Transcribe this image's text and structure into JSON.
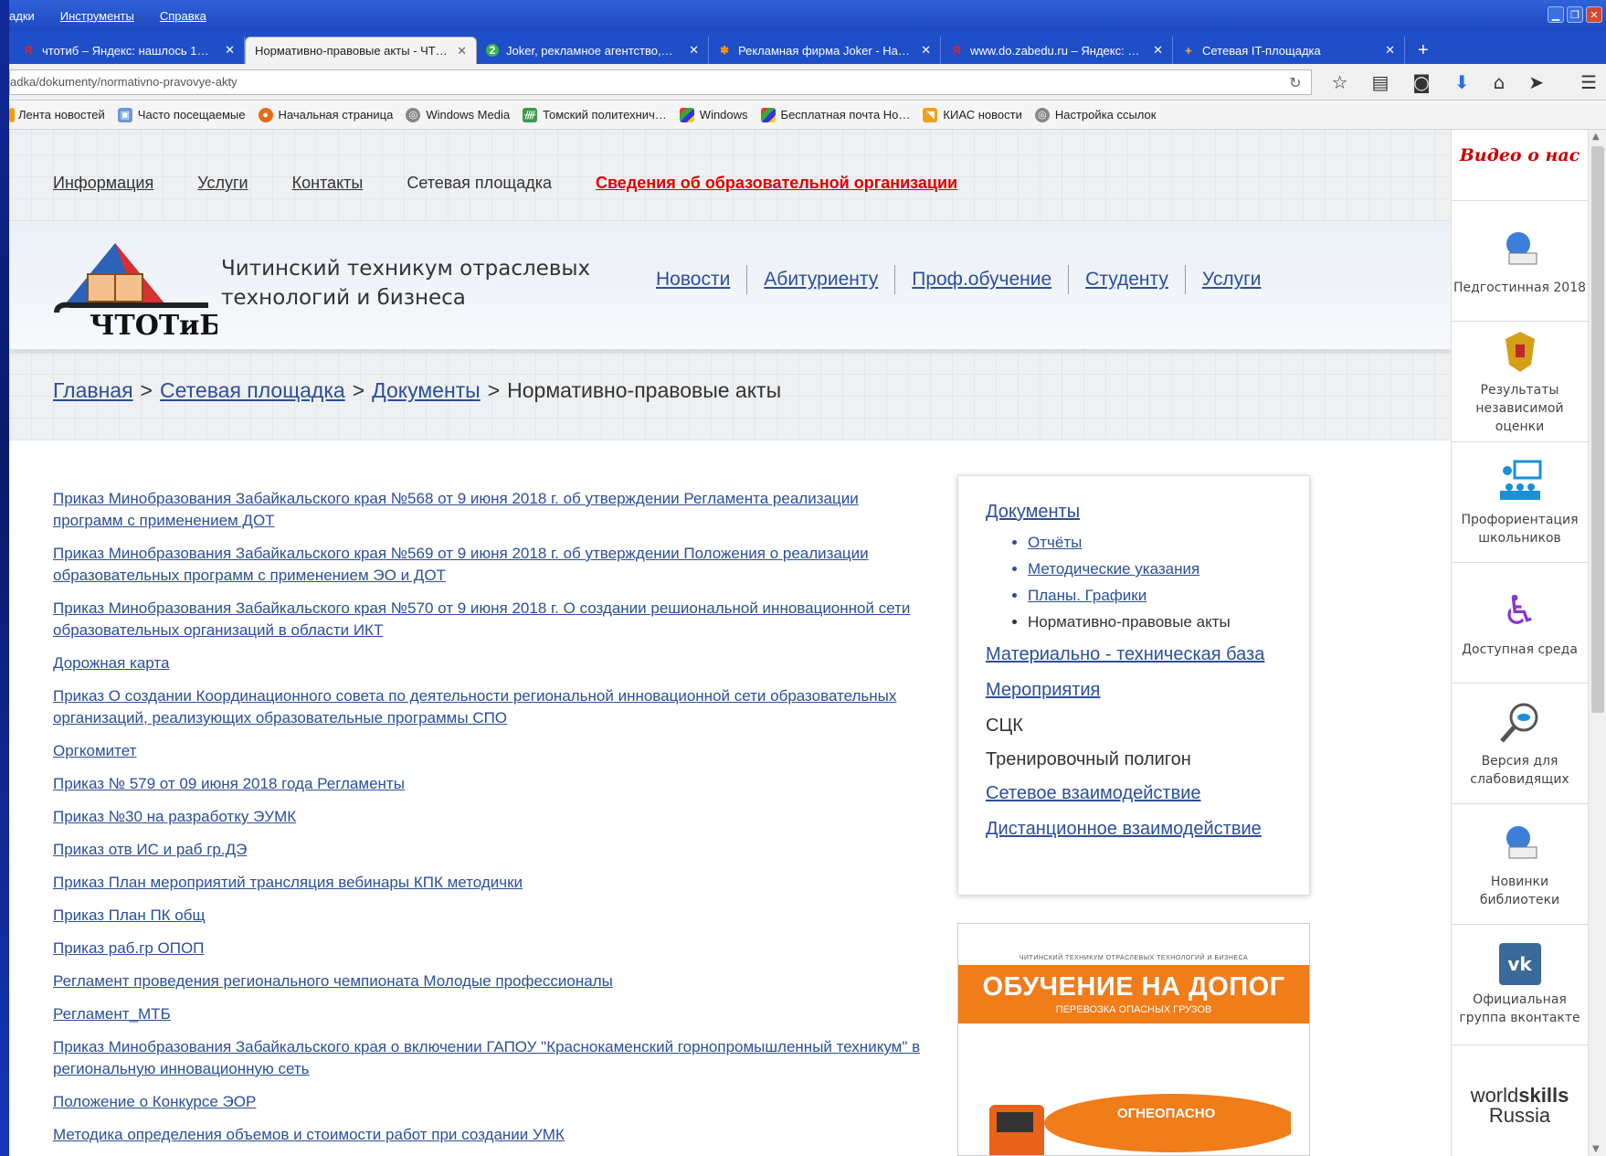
{
  "browser": {
    "menu": [
      "адки",
      "Инструменты",
      "Справка"
    ],
    "tabs": [
      {
        "title": "чтотиб – Яндекс: нашлось 1…",
        "active": false
      },
      {
        "title": "Нормативно-правовые акты - ЧТ…",
        "active": true
      },
      {
        "title": "Joker, рекламное агентство,…",
        "active": false
      },
      {
        "title": "Рекламная фирма Joker - На…",
        "active": false
      },
      {
        "title": "www.do.zabedu.ru – Яндекс: …",
        "active": false
      },
      {
        "title": "Сетевая IT-площадка",
        "active": false
      }
    ],
    "tab_close": "✕",
    "new_tab": "+",
    "tab3_badge": "2",
    "url": "adka/dokumenty/normativno-pravovye-akty",
    "bookmarks": [
      "Лента новостей",
      "Часто посещаемые",
      "Начальная страница",
      "Windows Media",
      "Томский политехнич…",
      "Windows",
      "Бесплатная почта Ho…",
      "КИАС новости",
      "Настройка ссылок"
    ]
  },
  "site": {
    "topnav": {
      "info": "Информация",
      "services": "Услуги",
      "contacts": "Контакты",
      "network": "Сетевая площадка",
      "edu_info": "Сведения об образовательной организации"
    },
    "org_name_line1": "Читинский техникум отраслевых",
    "org_name_line2": "технологий и бизнеса",
    "logo_text": "ЧТОТиБ",
    "main_menu": [
      "Новости",
      "Абитуриенту",
      "Проф.обучение",
      "Студенту",
      "Услуги"
    ],
    "breadcrumb": {
      "home": "Главная",
      "network": "Сетевая площадка",
      "docs": "Документы",
      "current": "Нормативно-правовые акты",
      "sep": ">"
    },
    "documents": [
      "Приказ Минобразования Забайкальского края №568 от 9 июня 2018 г.  об утверждении Регламента реализации программ с применением ДОТ",
      "Приказ Минобразования Забайкальского края №569 от 9 июня 2018 г. об утверждении Положения о реализации образовательных программ с применением ЭО и ДОТ",
      "Приказ Минобразования Забайкальского края №570 от 9 июня 2018 г. О создании решиональной инновационной сети образовательных организаций в области ИКТ",
      "Дорожная карта",
      "Приказ О создании Координационного совета по деятельности региональной инновационной сети образовательных организаций, реализующих образовательные программы СПО",
      "Оргкомитет",
      "Приказ № 579 от 09 июня 2018 года Регламенты",
      "Приказ №30 на разработку ЭУМК",
      "Приказ отв ИС и раб гр.ДЭ",
      "Приказ План мероприятий трансляция вебинары КПК методички",
      "Приказ План ПК общ",
      "Приказ раб.гр ОПОП",
      "Регламент проведения регионального чемпионата Молодые профессионалы",
      "Регламент_МТБ",
      "Приказ Минобразования Забайкальского края о включении ГАПОУ \"Краснокаменский горнопромышленный техникум\" в региональную инновационную сеть",
      "Положение о Конкурсе ЭОР",
      "Методика определения объемов и стоимости работ при создании УМК"
    ],
    "sidebar": {
      "docs": "Документы",
      "sub": [
        "Отчёты",
        "Методические указания",
        "Планы. Графики",
        "Нормативно-правовые акты"
      ],
      "mtb": "Материально - техническая база",
      "events": "Мероприятия",
      "sck": "СЦК",
      "polygon": "Тренировочный полигон",
      "network": "Сетевое взаимодействие",
      "distance": "Дистанционное взаимодействие"
    },
    "banner": {
      "small": "ЧИТИНСКИЙ ТЕХНИКУМ ОТРАСЛЕВЫХ ТЕХНОЛОГИЙ И БИЗНЕСА",
      "title": "ОБУЧЕНИЕ НА ДОПОГ",
      "subtitle": "ПЕРЕВОЗКА ОПАСНЫХ ГРУЗОВ",
      "truck_text": "ОГНЕОПАСНО"
    },
    "right_sidebar": {
      "video": "Видео о нас",
      "items": [
        "Педгостинная 2018",
        "Результаты независимой оценки",
        "Профориентация школьников",
        "Доступная среда",
        "Версия для слабовидящих",
        "Новинки библиотеки",
        "Официальная группа вконтакте"
      ],
      "worldskills_1": "world",
      "worldskills_2": "skills",
      "worldskills_3": "Russia"
    }
  }
}
